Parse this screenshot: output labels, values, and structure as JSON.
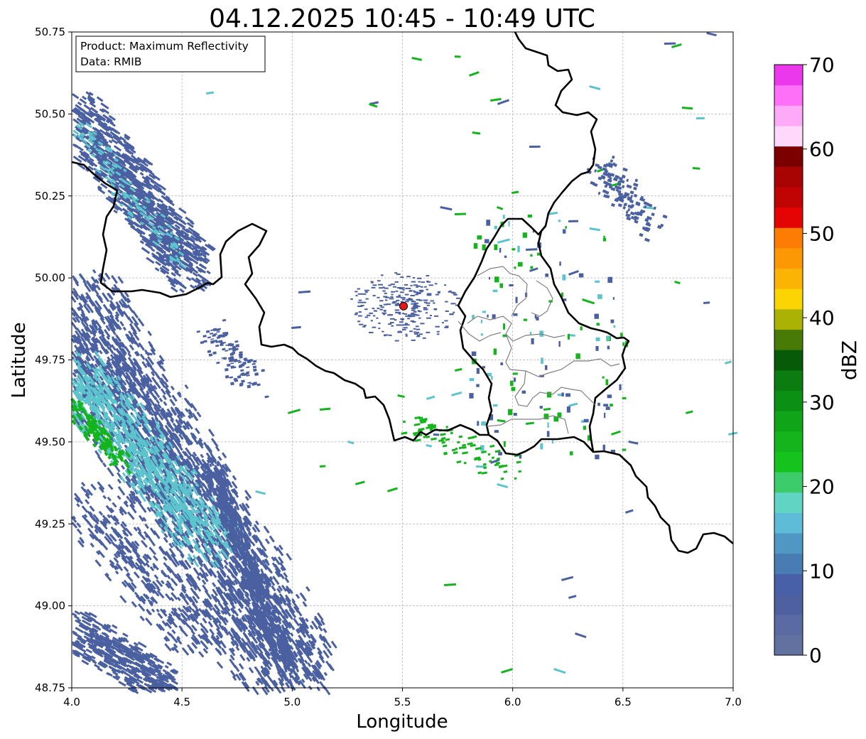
{
  "title": "04.12.2025 10:45 - 10:49 UTC",
  "info_box": {
    "product_line": "Product: Maximum Reflectivity",
    "data_line": "Data: RMIB"
  },
  "axes": {
    "xlabel": "Longitude",
    "ylabel": "Latitude",
    "xlim": [
      4.0,
      7.0
    ],
    "ylim": [
      48.75,
      50.75
    ],
    "x_ticks": [
      "4.0",
      "4.5",
      "5.0",
      "5.5",
      "6.0",
      "6.5",
      "7.0"
    ],
    "y_ticks": [
      "50.75",
      "50.50",
      "50.25",
      "50.00",
      "49.75",
      "49.50",
      "49.25",
      "49.00",
      "48.75"
    ],
    "grid": true
  },
  "colorbar": {
    "label": "dBZ",
    "range": [
      0,
      70
    ],
    "tick_labels": [
      "0",
      "10",
      "20",
      "30",
      "40",
      "50",
      "60",
      "70"
    ],
    "colors": [
      "#6272a0",
      "#5a6aa2",
      "#4e60a0",
      "#4860a8",
      "#4a7cb4",
      "#5098c4",
      "#5ebcd8",
      "#62d4c4",
      "#3ccc6c",
      "#14c41c",
      "#14b41c",
      "#10a418",
      "#0c9014",
      "#0a7c10",
      "#065a08",
      "#487a08",
      "#aab204",
      "#fcd404",
      "#fcb404",
      "#fc9804",
      "#fc7c04",
      "#e40404",
      "#c00404",
      "#a80404",
      "#7c0000",
      "#ffd8fc",
      "#ffaaf8",
      "#ff70f8",
      "#ec38ec"
    ]
  },
  "radar_site": {
    "lon": 5.505,
    "lat": 49.914,
    "color": "#e31a1c"
  },
  "map_colors": {
    "country_border": "#000000",
    "province_border": "#808080",
    "weak_echo": "#4a60a0",
    "moderate_echo": "#5cc4cc",
    "strong_echo": "#14b41c"
  }
}
